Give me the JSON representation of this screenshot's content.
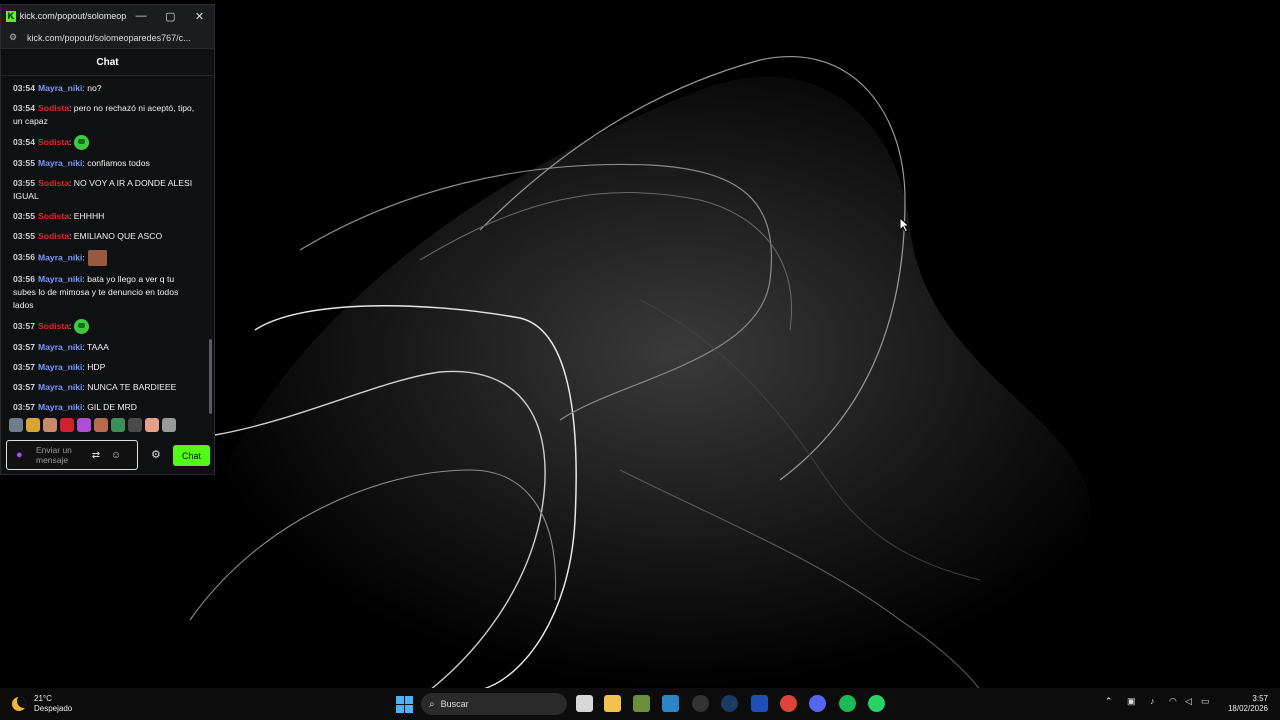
{
  "window": {
    "title": "kick.com/popout/solomeop...",
    "address": "kick.com/popout/solomeoparedes767/c...",
    "minimize_glyph": "—",
    "maximize_glyph": "▢",
    "close_glyph": "✕",
    "favicon_letter": "K"
  },
  "chat": {
    "header": "Chat",
    "messages": [
      {
        "time": "03:54",
        "user": "Mayra_niki",
        "color": "#7a96ff",
        "text": ": no?"
      },
      {
        "time": "03:54",
        "user": "Sodista",
        "color": "#e3242b",
        "text": ": pero no rechazó ni aceptó, tipo, un capaz"
      },
      {
        "time": "03:54",
        "user": "Sodista",
        "color": "#e3242b",
        "text": ":",
        "emote": "green-emote"
      },
      {
        "time": "03:55",
        "user": "Mayra_niki",
        "color": "#7a96ff",
        "text": ": confiamos todos"
      },
      {
        "time": "03:55",
        "user": "Sodista",
        "color": "#e3242b",
        "text": ": NO VOY A IR A DONDE ALESI IGUAL"
      },
      {
        "time": "03:55",
        "user": "Sodista",
        "color": "#e3242b",
        "text": ": EHHHH"
      },
      {
        "time": "03:55",
        "user": "Sodista",
        "color": "#e3242b",
        "text": ": EMILIANO QUE ASCO"
      },
      {
        "time": "03:56",
        "user": "Mayra_niki",
        "color": "#7a96ff",
        "text": ":",
        "emote": "face-emote"
      },
      {
        "time": "03:56",
        "user": "Mayra_niki",
        "color": "#7a96ff",
        "text": ": bata yo llego a ver q tu subes lo de mimosa y te denuncio en todos lados"
      },
      {
        "time": "03:57",
        "user": "Sodista",
        "color": "#e3242b",
        "text": ":",
        "emote": "green-emote"
      },
      {
        "time": "03:57",
        "user": "Mayra_niki",
        "color": "#7a96ff",
        "text": ": TAAA"
      },
      {
        "time": "03:57",
        "user": "Mayra_niki",
        "color": "#7a96ff",
        "text": ": HDP"
      },
      {
        "time": "03:57",
        "user": "Mayra_niki",
        "color": "#7a96ff",
        "text": ": NUNCA TE BARDIEEE"
      },
      {
        "time": "03:57",
        "user": "Mayra_niki",
        "color": "#7a96ff",
        "text": ": GIL DE MRD"
      }
    ],
    "input_placeholder": "Enviar un mensaje",
    "send_label": "Chat"
  },
  "taskbar": {
    "temperature": "21°C",
    "condition": "Despejado",
    "search_text": "Buscar",
    "time": "3:57",
    "date": "18/02/2026"
  },
  "colors": {
    "accent": "#53fc18",
    "user_blue": "#7a96ff",
    "user_red": "#e3242b"
  }
}
